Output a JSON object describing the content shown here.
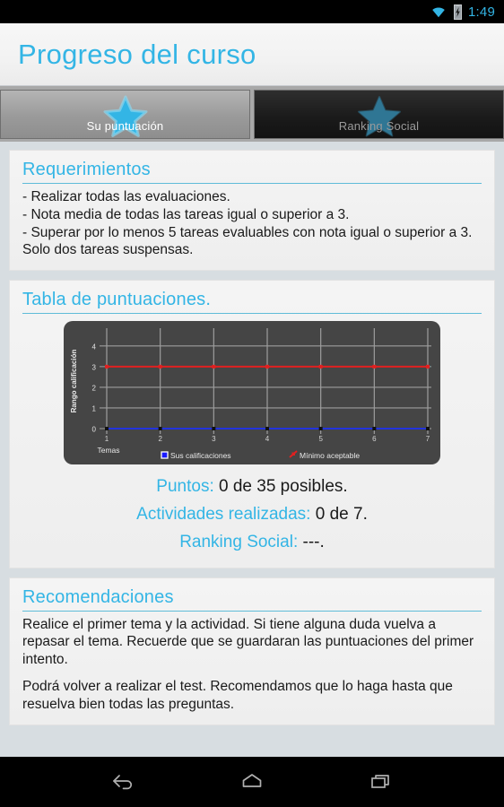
{
  "statusbar": {
    "time": "1:49",
    "wifi_icon": "wifi-icon",
    "battery_icon": "battery-charging-icon"
  },
  "actionbar": {
    "title": "Progreso del curso"
  },
  "tabs": [
    {
      "label": "Su puntuación",
      "icon": "star-icon",
      "selected": true
    },
    {
      "label": "Ranking Social",
      "icon": "star-icon",
      "selected": false
    }
  ],
  "requirements": {
    "heading": "Requerimientos",
    "body": "- Realizar todas las evaluaciones.\n- Nota media de todas las tareas igual o superior a 3.\n- Superar por lo menos 5 tareas evaluables con nota igual o superior a 3. Solo dos tareas suspensas."
  },
  "scores": {
    "heading": "Tabla de puntuaciones.",
    "stats": [
      {
        "label": "Puntos:",
        "value": "0 de 35 posibles."
      },
      {
        "label": "Actividades realizadas:",
        "value": "0 de 7."
      },
      {
        "label": "Ranking Social:",
        "value": "---."
      }
    ]
  },
  "chart_data": {
    "type": "line",
    "title": "",
    "xlabel": "Temas",
    "ylabel": "Rango calificación",
    "x": [
      1,
      2,
      3,
      4,
      5,
      6,
      7
    ],
    "xticklabels": [
      "1",
      "2",
      "3",
      "4",
      "5",
      "6",
      "7"
    ],
    "yticklabels": [
      "0",
      "1",
      "2",
      "3",
      "4"
    ],
    "ylim": [
      0,
      4.6
    ],
    "xlim": [
      1,
      7
    ],
    "grid": true,
    "legend_position": "bottom",
    "background": "#454545",
    "series": [
      {
        "name": "Sus calificaciones",
        "color": "#2233dd",
        "marker_color": "#111111",
        "values": [
          0,
          0,
          0,
          0,
          0,
          0,
          0
        ]
      },
      {
        "name": "Mínimo aceptable",
        "color": "#e02020",
        "marker_color": "#e02020",
        "values": [
          3,
          3,
          3,
          3,
          3,
          3,
          3
        ]
      }
    ]
  },
  "recommendations": {
    "heading": "Recomendaciones",
    "paragraph1": "Realice el primer tema y la actividad. Si tiene alguna duda vuelva a repasar el tema. Recuerde que se guardaran las puntuaciones del primer intento.",
    "paragraph2": "Podrá volver a realizar el test. Recomendamos que lo haga hasta que resuelva bien todas las preguntas."
  },
  "navbar": [
    {
      "name": "back-icon"
    },
    {
      "name": "home-icon"
    },
    {
      "name": "recents-icon"
    }
  ],
  "colors": {
    "accent": "#33b5e5",
    "page_bg": "#d7dde1",
    "chart_bg": "#454545",
    "series_blue": "#2233dd",
    "series_red": "#e02020"
  }
}
